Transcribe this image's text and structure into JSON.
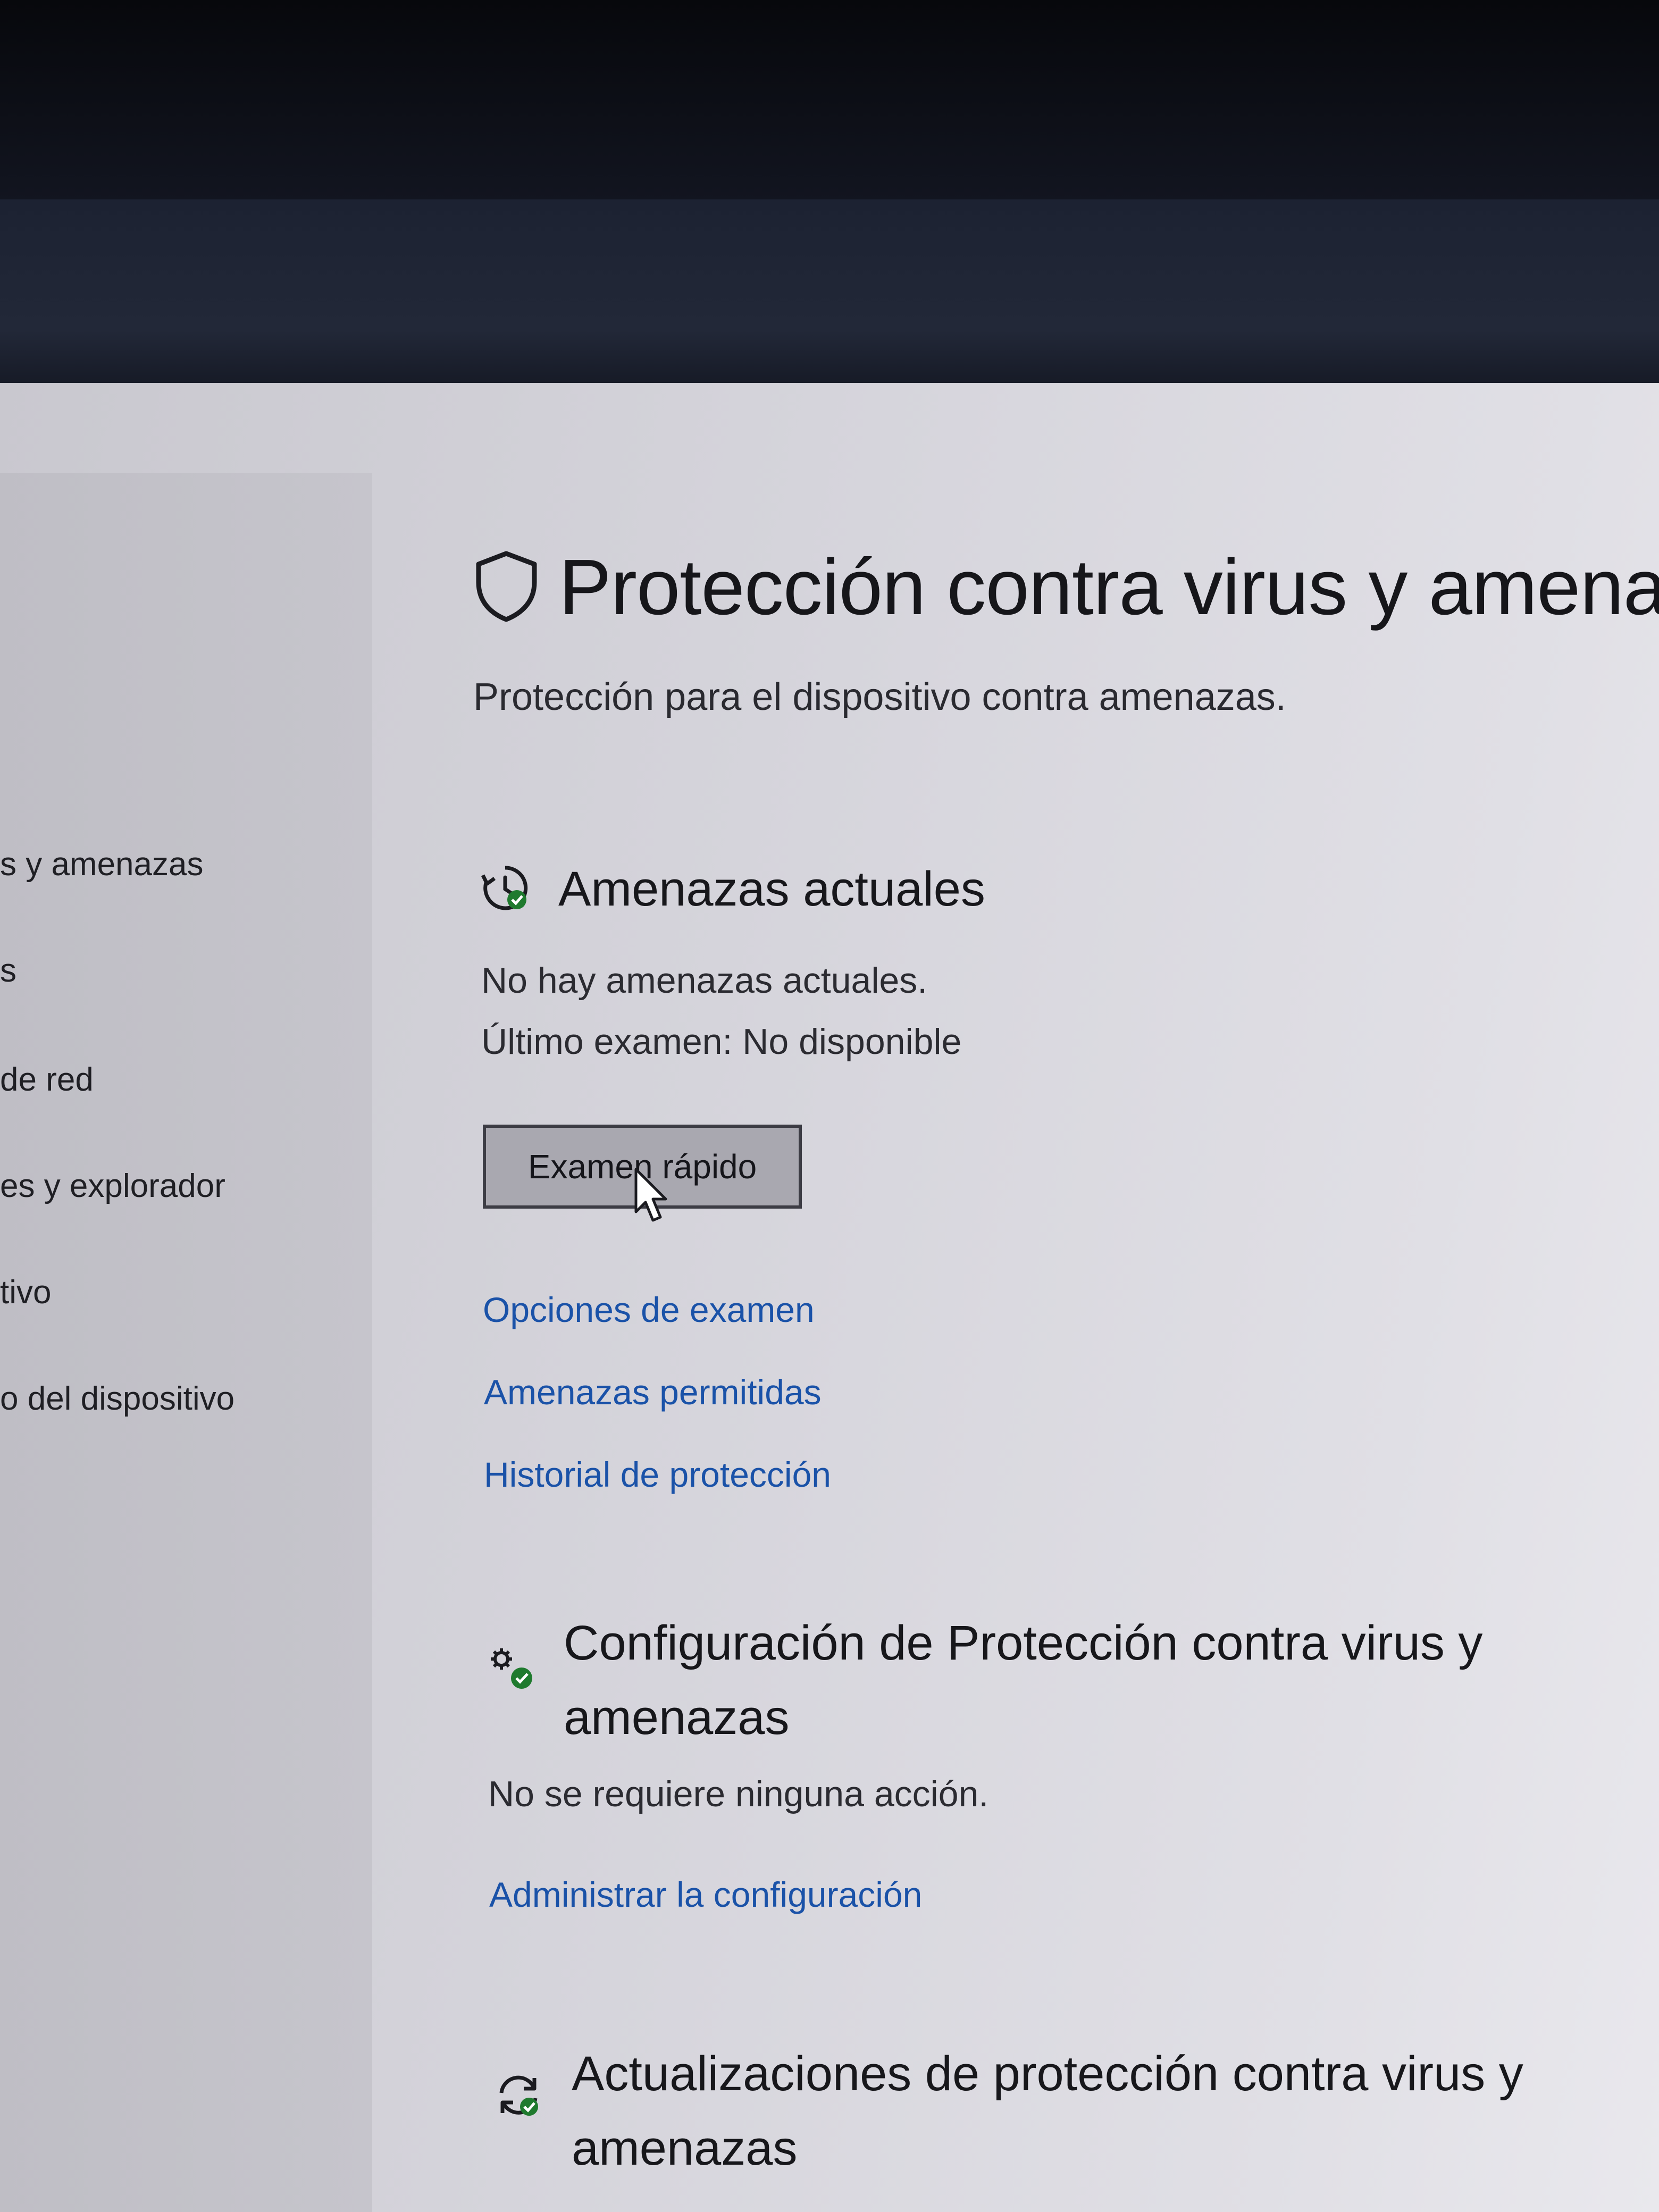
{
  "sidebar": {
    "items": [
      {
        "label": "s y amenazas"
      },
      {
        "label": "s"
      },
      {
        "label": "de red"
      },
      {
        "label": "es y explorador"
      },
      {
        "label": "tivo"
      },
      {
        "label": "o del dispositivo"
      }
    ]
  },
  "page": {
    "title": "Protección contra virus y amenaza",
    "subtitle": "Protección para el dispositivo contra amenazas.",
    "icon": "shield-icon"
  },
  "current_threats": {
    "title": "Amenazas actuales",
    "icon": "clock-check-icon",
    "status": "No hay amenazas actuales.",
    "last_scan": "Último examen: No disponible",
    "quick_scan_label": "Examen rápido",
    "links": [
      "Opciones de examen",
      "Amenazas permitidas",
      "Historial de protección"
    ]
  },
  "settings": {
    "title": "Configuración de Protección contra virus y amenazas",
    "icon": "gears-check-icon",
    "status": "No se requiere ninguna acción.",
    "link": "Administrar la configuración"
  },
  "updates": {
    "title": "Actualizaciones de protección contra virus y amenazas",
    "icon": "refresh-check-icon"
  },
  "colors": {
    "link": "#1a52a8",
    "status_green": "#1f7a2e",
    "window_bg": "#d6d5dc",
    "sidebar_bg": "#c3c2c9"
  }
}
